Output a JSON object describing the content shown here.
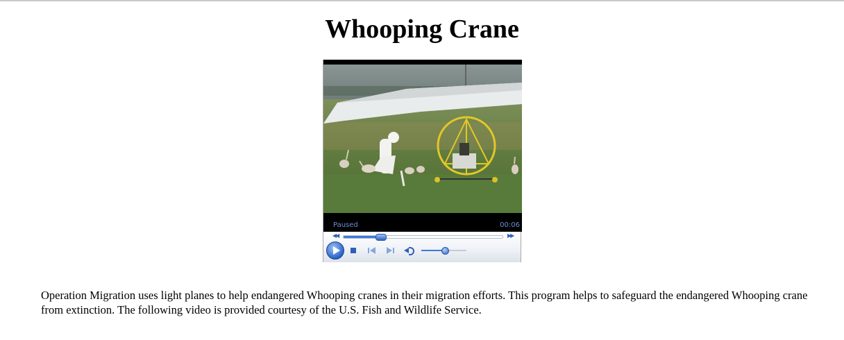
{
  "page": {
    "title": "Whooping Crane",
    "description": "Operation Migration uses light planes to help endangered Whooping cranes in their migration efforts. This program helps to safeguard the endangered Whooping crane from extinction. The following video is provided courtesy of the U.S. Fish and Wildlife Service."
  },
  "player": {
    "status": "Paused",
    "time": "00:06",
    "progress": 0.23,
    "volume": 0.5,
    "video_content": "costumed handler with whooping crane chicks beside an ultralight aircraft on a grassy field",
    "icons": {
      "seek_back": "rewind-icon",
      "seek_forward": "fast-forward-icon",
      "play": "play-icon",
      "stop": "stop-icon",
      "previous": "previous-track-icon",
      "next": "next-track-icon",
      "volume": "speaker-icon"
    },
    "colors": {
      "status_text": "#6b8fd6",
      "accent": "#2f5fb8"
    }
  }
}
